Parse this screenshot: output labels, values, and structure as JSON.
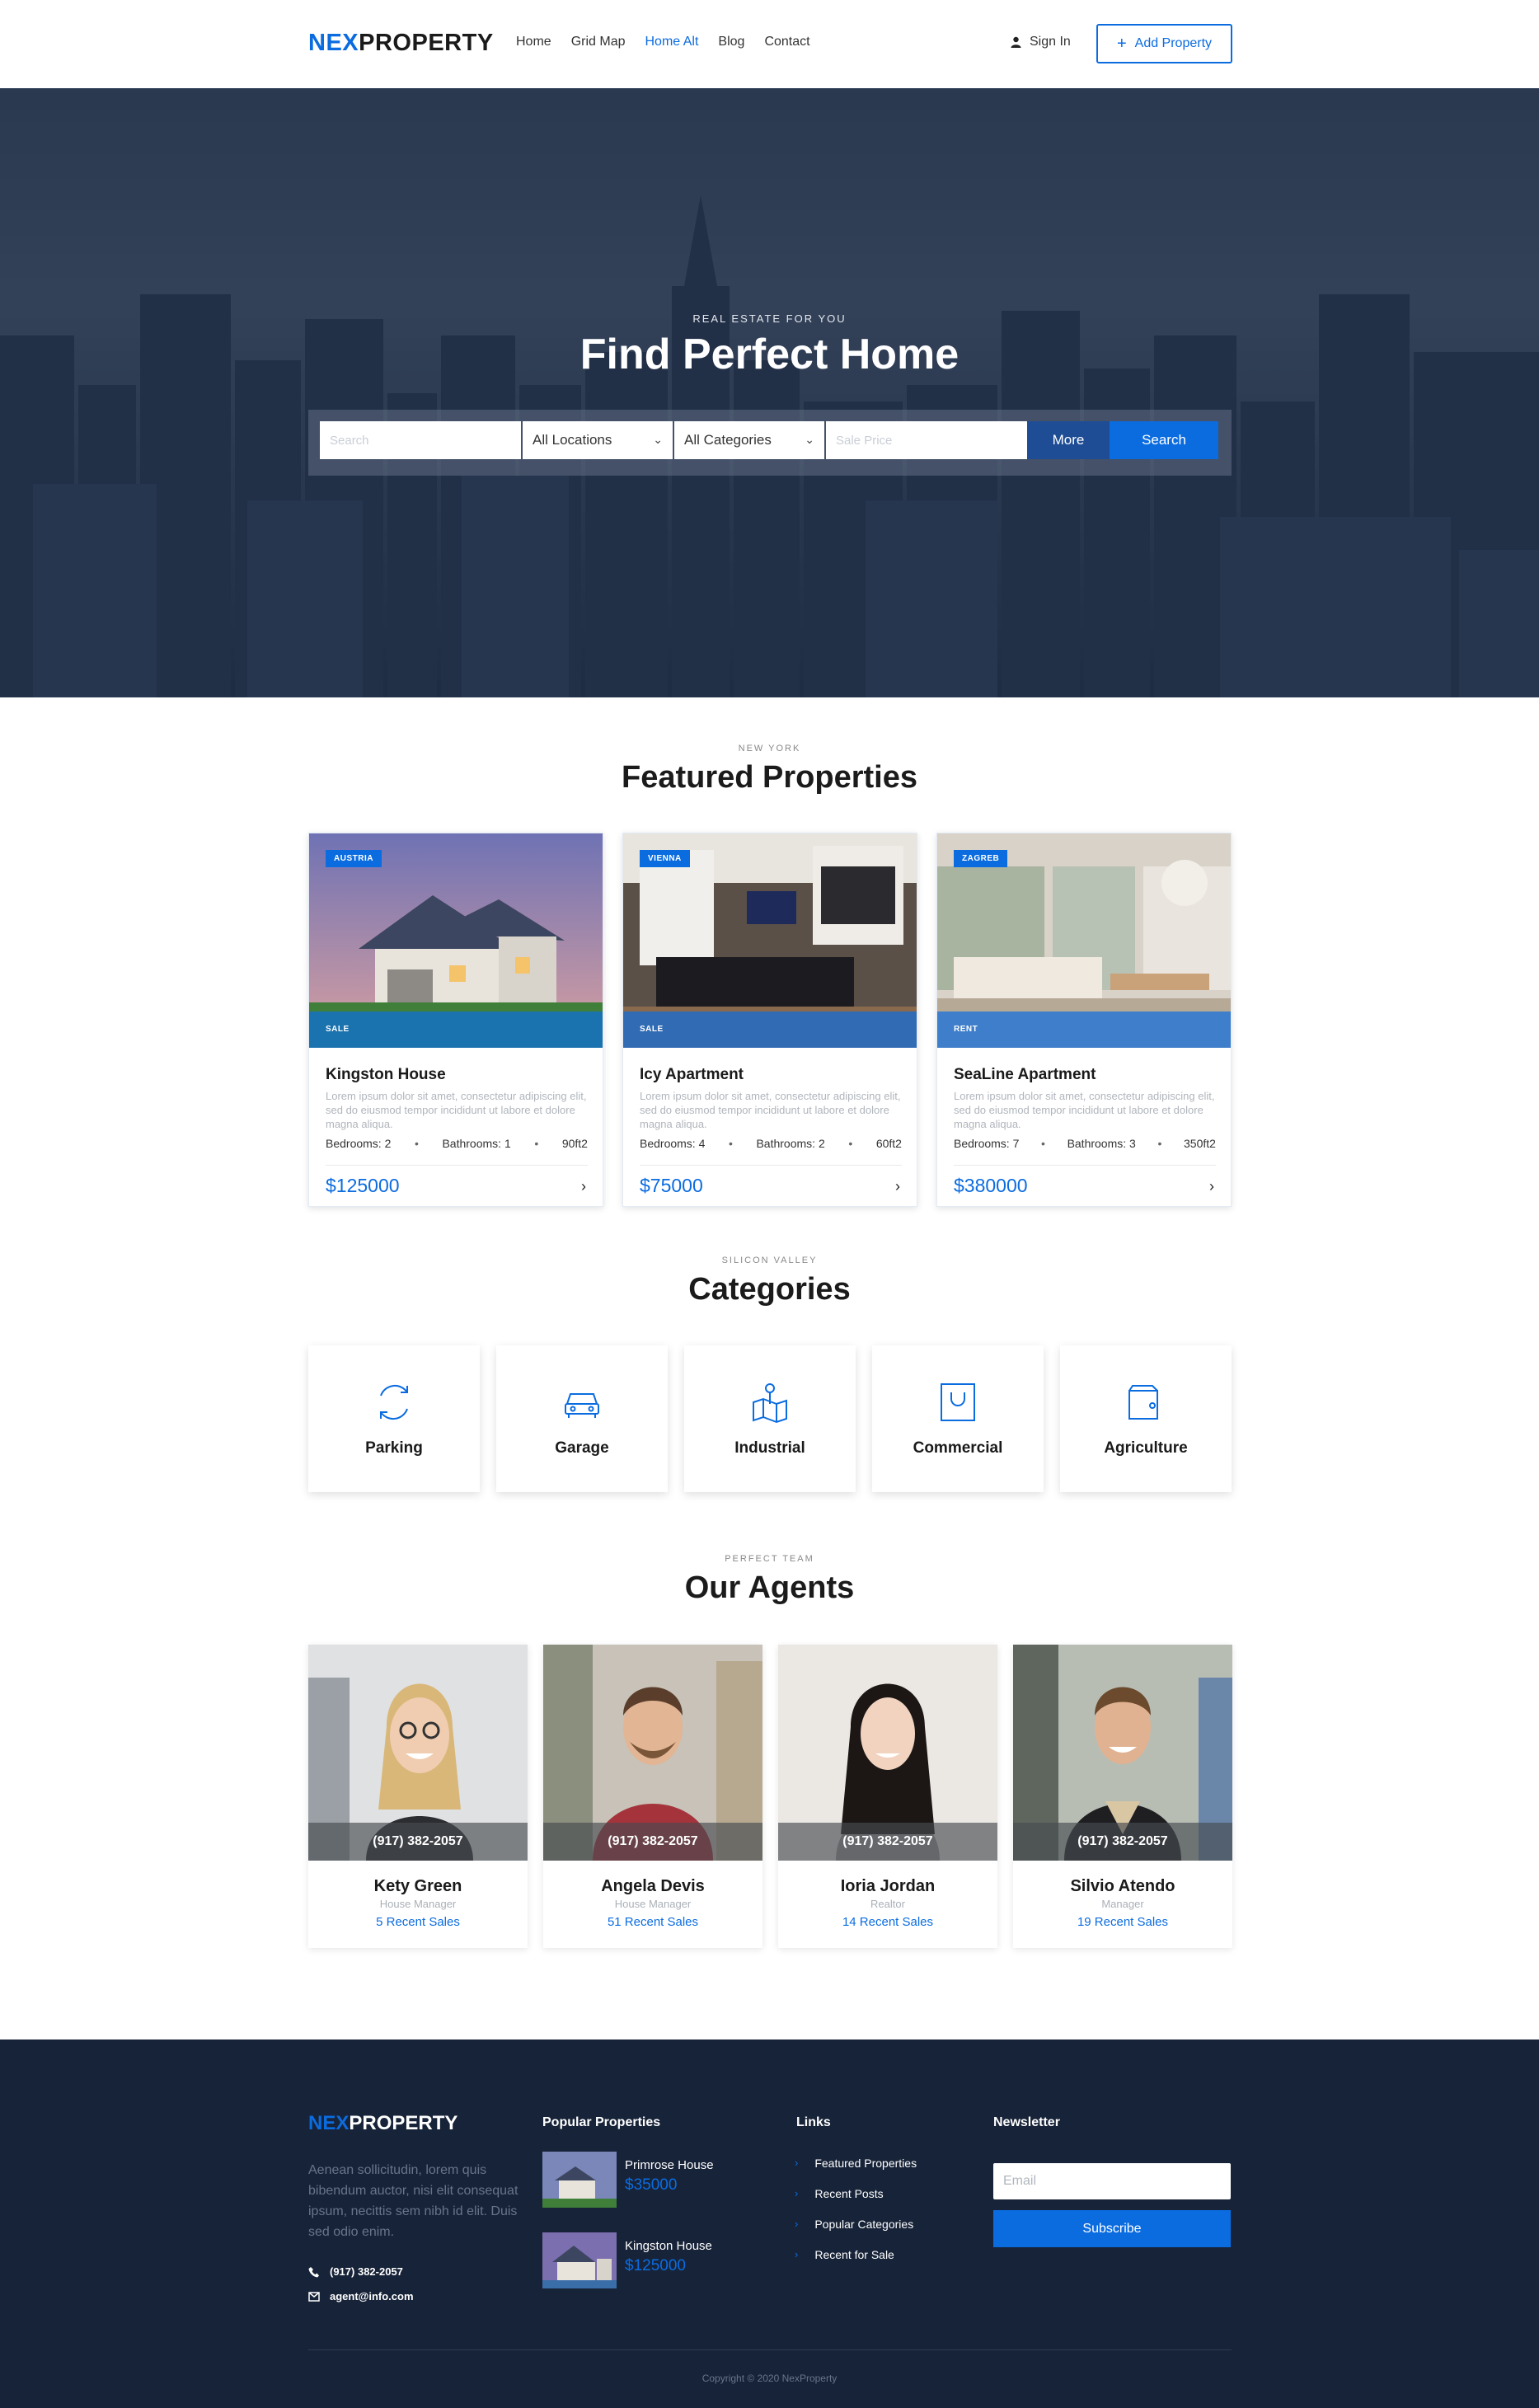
{
  "header": {
    "logo_accent": "NEX",
    "logo_rest": "PROPERTY",
    "nav": [
      "Home",
      "Grid Map",
      "Home Alt",
      "Blog",
      "Contact"
    ],
    "active_nav": "Home Alt",
    "signin_label": "Sign In",
    "add_property_label": "Add Property"
  },
  "hero": {
    "subtitle": "REAL ESTATE FOR YOU",
    "title": "Find Perfect Home",
    "search_placeholder": "Search",
    "location_select": "All Locations",
    "category_select": "All Categories",
    "price_placeholder": "Sale Price",
    "more_label": "More",
    "search_label": "Search"
  },
  "featured": {
    "kicker": "NEW YORK",
    "title": "Featured Properties",
    "cards": [
      {
        "tag": "AUSTRIA",
        "status": "SALE",
        "title": "Kingston House",
        "desc": "Lorem ipsum dolor sit amet, consectetur adipiscing elit, sed do eiusmod tempor incididunt ut labore et dolore magna aliqua.",
        "bedrooms": "Bedrooms: 2",
        "bathrooms": "Bathrooms: 1",
        "area": "90ft2",
        "price": "$125000"
      },
      {
        "tag": "VIENNA",
        "status": "SALE",
        "title": "Icy Apartment",
        "desc": "Lorem ipsum dolor sit amet, consectetur adipiscing elit, sed do eiusmod tempor incididunt ut labore et dolore magna aliqua.",
        "bedrooms": "Bedrooms: 4",
        "bathrooms": "Bathrooms: 2",
        "area": "60ft2",
        "price": "$75000"
      },
      {
        "tag": "ZAGREB",
        "status": "RENT",
        "title": "SeaLine Apartment",
        "desc": "Lorem ipsum dolor sit amet, consectetur adipiscing elit, sed do eiusmod tempor incididunt ut labore et dolore magna aliqua.",
        "bedrooms": "Bedrooms: 7",
        "bathrooms": "Bathrooms: 3",
        "area": "350ft2",
        "price": "$380000"
      }
    ]
  },
  "categories": {
    "kicker": "SILICON VALLEY",
    "title": "Categories",
    "items": [
      {
        "label": "Parking",
        "icon": "refresh-icon"
      },
      {
        "label": "Garage",
        "icon": "car-icon"
      },
      {
        "label": "Industrial",
        "icon": "map-pin-icon"
      },
      {
        "label": "Commercial",
        "icon": "shopping-bag-icon"
      },
      {
        "label": "Agriculture",
        "icon": "wallet-icon"
      }
    ]
  },
  "agents": {
    "kicker": "PERFECT TEAM",
    "title": "Our Agents",
    "items": [
      {
        "phone": "(917) 382-2057",
        "name": "Kety Green",
        "role": "House Manager",
        "sales": "5 Recent Sales"
      },
      {
        "phone": "(917) 382-2057",
        "name": "Angela Devis",
        "role": "House Manager",
        "sales": "51 Recent Sales"
      },
      {
        "phone": "(917) 382-2057",
        "name": "Ioria Jordan",
        "role": "Realtor",
        "sales": "14 Recent Sales"
      },
      {
        "phone": "(917) 382-2057",
        "name": "Silvio Atendo",
        "role": "Manager",
        "sales": "19 Recent Sales"
      }
    ]
  },
  "footer": {
    "logo_accent": "NEX",
    "logo_rest": "PROPERTY",
    "about": "Aenean sollicitudin, lorem quis bibendum auctor, nisi elit consequat ipsum, necittis sem nibh id elit. Duis sed odio enim.",
    "phone": "(917) 382-2057",
    "email": "agent@info.com",
    "popular_title": "Popular Properties",
    "popular": [
      {
        "name": "Primrose House",
        "price": "$35000"
      },
      {
        "name": "Kingston House",
        "price": "$125000"
      }
    ],
    "links_title": "Links",
    "links": [
      "Featured Properties",
      "Recent Posts",
      "Popular Categories",
      "Recent for Sale"
    ],
    "newsletter_title": "Newsletter",
    "email_placeholder": "Email",
    "subscribe_label": "Subscribe",
    "copyright": "Copyright © 2020 NexProperty"
  },
  "colors": {
    "accent": "#0b6ce0",
    "footer_bg": "#172338"
  }
}
